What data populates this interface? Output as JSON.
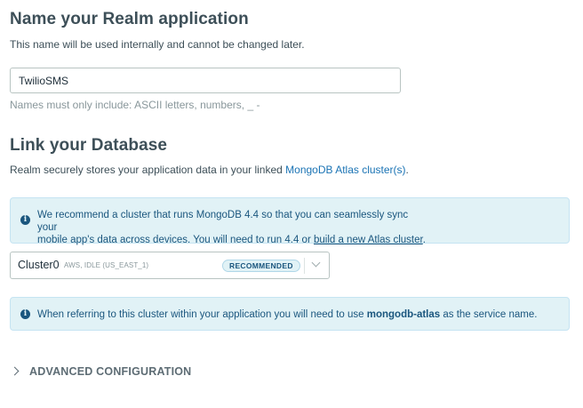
{
  "name_section": {
    "title": "Name your Realm application",
    "description": "This name will be used internally and cannot be changed later.",
    "input_value": "TwilioSMS",
    "hint": "Names must only include: ASCII letters, numbers, _ -"
  },
  "db_section": {
    "title": "Link your Database",
    "description_prefix": "Realm securely stores your application data in your linked ",
    "description_link": "MongoDB Atlas cluster(s)",
    "description_suffix": "."
  },
  "recommend_banner": {
    "line1": "We recommend a cluster that runs MongoDB 4.4 so that you can seamlessly sync your",
    "line2_prefix": "mobile app's data across devices. You will need to run 4.4 or ",
    "line2_link": "build a new Atlas cluster",
    "line2_suffix": "."
  },
  "cluster_select": {
    "name": "Cluster0",
    "meta": "AWS, IDLE (US_EAST_1)",
    "badge": "RECOMMENDED"
  },
  "service_banner": {
    "prefix": "When referring to this cluster within your application you will need to use ",
    "service_name": "mongodb-atlas",
    "suffix": " as the service name."
  },
  "advanced": {
    "label": "ADVANCED CONFIGURATION"
  },
  "icons": [
    "info-icon",
    "chevron-down-icon",
    "chevron-right-icon"
  ],
  "colors": {
    "heading": "#3d4f58",
    "link": "#1a73b4",
    "banner_bg": "#e1f2f6",
    "banner_text": "#1a567e"
  }
}
